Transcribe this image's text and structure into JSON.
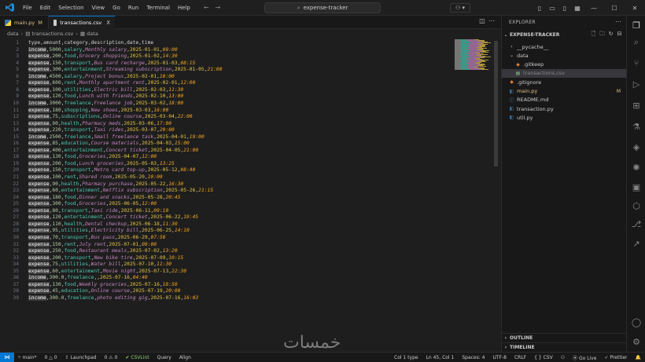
{
  "menu": [
    "File",
    "Edit",
    "Selection",
    "View",
    "Go",
    "Run",
    "Terminal",
    "Help"
  ],
  "command_center": "expense-tracker",
  "tabs": [
    {
      "label": "main.py",
      "modified": "M"
    },
    {
      "label": "transactions.csv",
      "close": "X"
    }
  ],
  "breadcrumb": [
    "data",
    "transactions.csv",
    "data"
  ],
  "code_lines": [
    "type,amount,category,description,date,time",
    "income,5000,salary,Monthly salary,2025-01-01,09:00",
    "expense,200,food,Grocery shopping,2025-01-02,14:30",
    "expense,150,transport,Bus card recharge,2025-01-03,08:15",
    "expense,300,entertainment,Streaming subscription,2025-01-05,21:00",
    "income,4500,salary,Project bonus,2025-02-01,10:00",
    "expense,600,rent,Monthly apartment rent,2025-02-01,12:00",
    "expense,100,utilities,Electric bill,2025-02-03,11:30",
    "expense,120,food,Lunch with friends,2025-02-10,13:00",
    "income,3000,freelance,Freelance job,2025-03-02,18:00",
    "expense,180,shopping,New shoes,2025-03-03,16:00",
    "expense,75,subscriptions,Online course,2025-03-04,22:00",
    "expense,90,health,Pharmacy meds,2025-03-06,17:00",
    "expense,220,transport,Taxi rides,2025-03-07,20:00",
    "income,2500,freelance,Small freelance task,2025-04-01,19:00",
    "expense,85,education,Course materials,2025-04-03,15:00",
    "expense,400,entertainment,Concert ticket,2025-04-05,21:00",
    "expense,130,food,Groceries,2025-04-07,12:00",
    "expense,200,food,Lunch groceries,2025-05-03,13:25",
    "expense,150,transport,Metro card top-up,2025-05-12,08:40",
    "expense,100,rent,Shared room,2025-05-20,10:00",
    "expense,90,health,Pharmacy purchase,2025-05-22,16:30",
    "expense,60,entertainment,Netflix subscription,2025-05-26,21:15",
    "expense,180,food,Dinner and snacks,2025-05-28,20:45",
    "expense,300,food,Groceries,2025-06-05,12:00",
    "expense,80,transport,Taxi ride,2025-06-11,09:10",
    "expense,120,entertainment,Concert ticket,2025-06-22,19:45",
    "expense,110,health,Dental checkup,2025-06-18,11:30",
    "expense,95,utilities,Electricity bill,2025-06-25,14:10",
    "expense,70,transport,Bus pass,2025-06-29,07:50",
    "expense,150,rent,July rent,2025-07-01,09:00",
    "expense,250,food,Restaurant meals,2025-07-02,13:20",
    "expense,200,transport,New bike tire,2025-07-09,10:15",
    "expense,75,utilities,Water bill,2025-07-10,11:30",
    "expense,60,entertainment,Movie night,2025-07-13,22:30",
    "income,300.0,freelance,,2025-07-16,04:40",
    "expense,130,food,Weekly groceries,2025-07-16,18:50",
    "expense,45,education,Online course,2025-07-19,20:00",
    "income,300.0,freelance,photo editing gig,2025-07-16,16:03"
  ],
  "explorer": {
    "header": "EXPLORER",
    "root": "EXPENSE-TRACKER",
    "items": [
      {
        "label": "__pycache__",
        "indent": 1,
        "kind": "folder-closed"
      },
      {
        "label": "data",
        "indent": 1,
        "kind": "folder-open"
      },
      {
        "label": ".gitkeep",
        "indent": 2,
        "kind": "file"
      },
      {
        "label": "transactions.csv",
        "indent": 2,
        "kind": "csv",
        "selected": true
      },
      {
        "label": ".gitignore",
        "indent": 1,
        "kind": "git"
      },
      {
        "label": "main.py",
        "indent": 1,
        "kind": "py",
        "badge": "M"
      },
      {
        "label": "README.md",
        "indent": 1,
        "kind": "md"
      },
      {
        "label": "transaction.py",
        "indent": 1,
        "kind": "py"
      },
      {
        "label": "util.py",
        "indent": 1,
        "kind": "py"
      }
    ],
    "outline": "OUTLINE",
    "timeline": "TIMELINE"
  },
  "status": {
    "branch": "main*",
    "sync": "0 △ 0",
    "problems": "0 ⚠ 0",
    "launchpad": "Launchpad",
    "errors": "0 ⚠ 0",
    "csvlint": "CSVLint",
    "query": "Query",
    "align": "Align",
    "col": "Col 1 type",
    "ln": "Ln 45, Col 1",
    "spaces": "Spaces: 4",
    "enc": "UTF-8",
    "eol": "CRLF",
    "lang": "CSV",
    "golive": "Go Live",
    "prettier": "Prettier"
  },
  "colors": {
    "accent": "#0078d4",
    "modified": "#e2c08d"
  }
}
